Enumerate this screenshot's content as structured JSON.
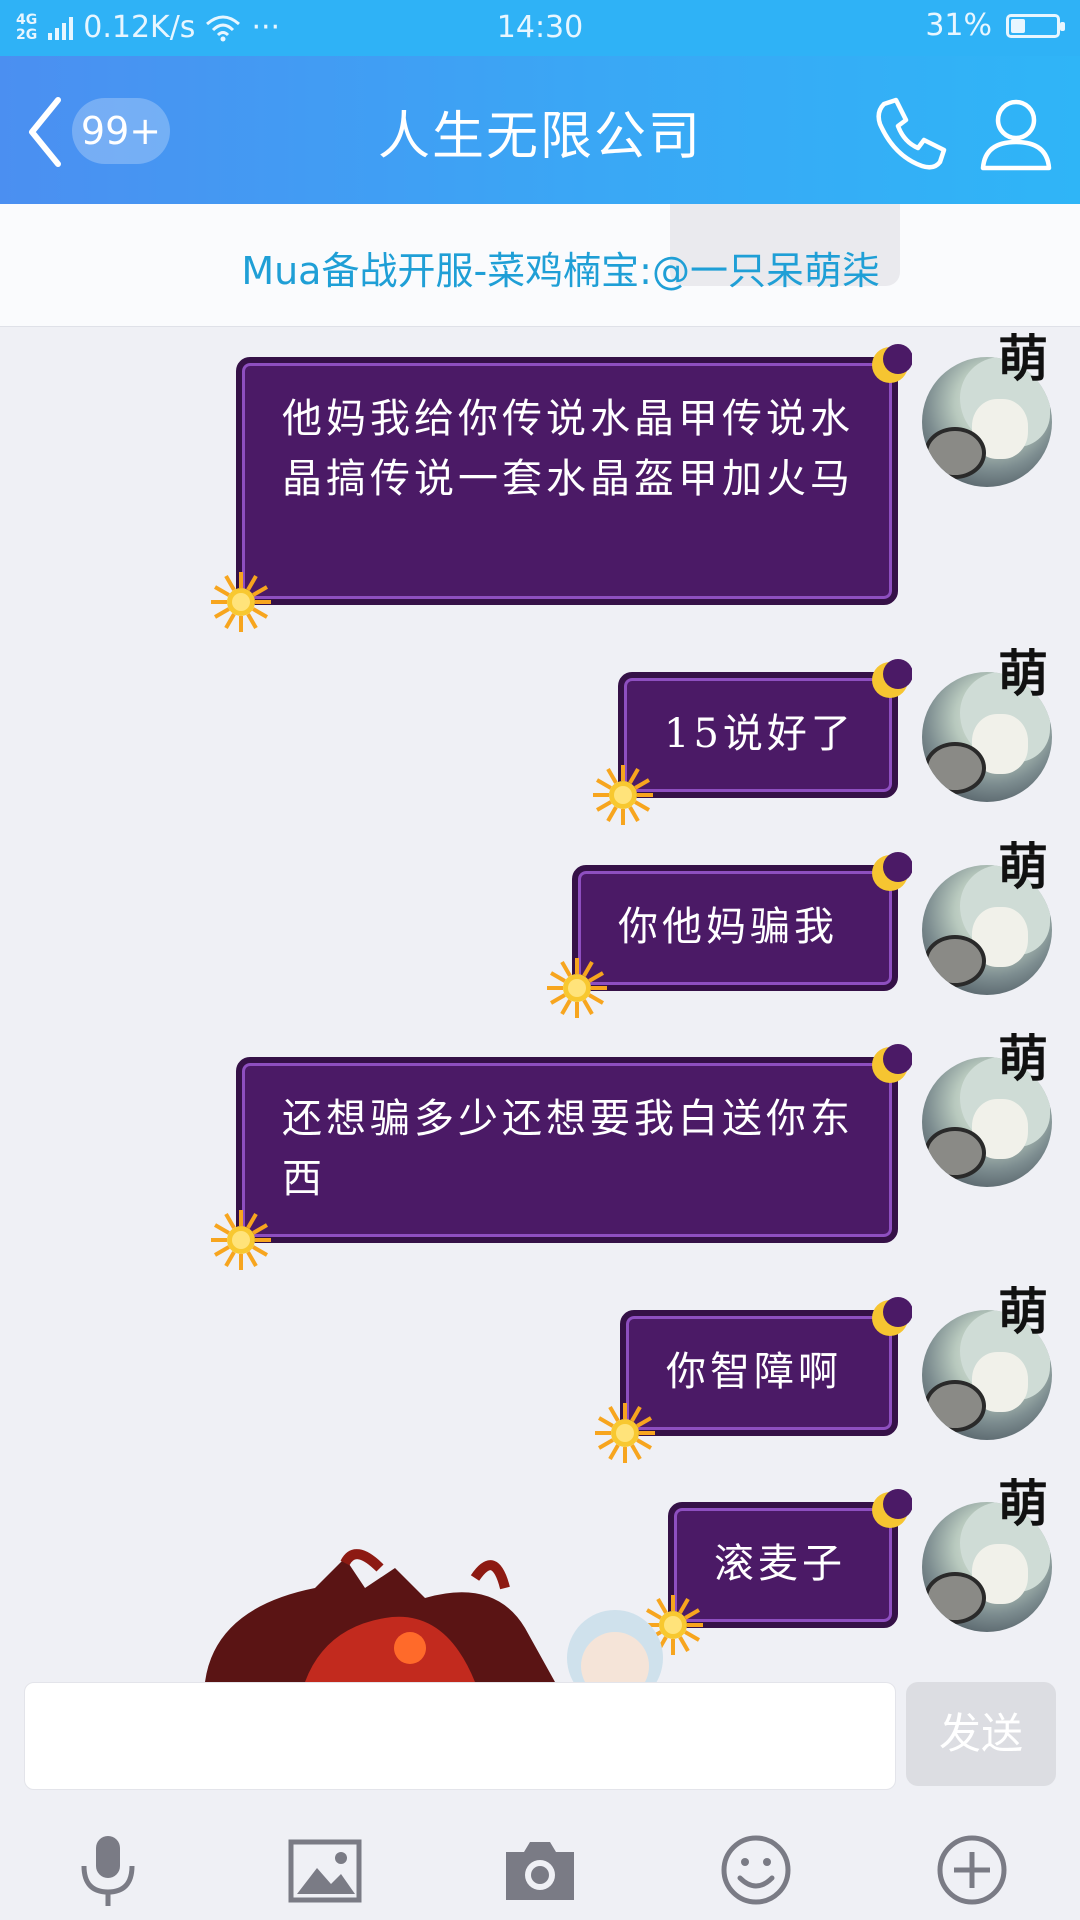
{
  "status_bar": {
    "network_top": "4G",
    "network_bottom": "2G",
    "speed": "0.12K/s",
    "more": "···",
    "time": "14:30",
    "battery": "31%",
    "battery_level": 0.31
  },
  "header": {
    "unread_badge": "99+",
    "title": "人生无限公司",
    "back_icon": "chevron-left-icon",
    "call_icon": "phone-icon",
    "profile_icon": "person-icon"
  },
  "notice": {
    "text": "Mua备战开服-菜鸡楠宝:@一只呆萌柒"
  },
  "messages": [
    {
      "text": "他妈我给你传说水晶甲传说水晶搞传说一套水晶盔甲加火马",
      "avatar_tag": "萌"
    },
    {
      "text": "15说好了",
      "avatar_tag": "萌"
    },
    {
      "text": "你他妈骗我",
      "avatar_tag": "萌"
    },
    {
      "text": "还想骗多少还想要我白送你东西",
      "avatar_tag": "萌"
    },
    {
      "text": "你智障啊",
      "avatar_tag": "萌"
    },
    {
      "text": "滚麦子",
      "avatar_tag": "萌"
    }
  ],
  "composer": {
    "input_value": "",
    "send_label": "发送"
  },
  "toolbar": [
    "microphone-icon",
    "image-icon",
    "camera-icon",
    "emoji-icon",
    "plus-icon"
  ],
  "colors": {
    "header_start": "#4b8ff1",
    "header_end": "#2fb5f7",
    "bubble_fill": "#4b1a66",
    "notice_text": "#1f9fd6",
    "background": "#eff0f5"
  }
}
